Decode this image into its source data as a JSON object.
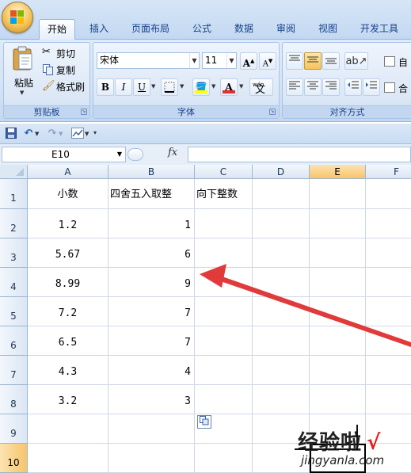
{
  "ribbon_tabs": [
    "开始",
    "插入",
    "页面布局",
    "公式",
    "数据",
    "审阅",
    "视图",
    "开发工具"
  ],
  "clipboard": {
    "paste_label": "粘贴",
    "cut_label": "剪切",
    "copy_label": "复制",
    "format_painter_label": "格式刷",
    "group_label": "剪贴板"
  },
  "font": {
    "name": "宋体",
    "size": "11",
    "grow_label": "A",
    "shrink_label": "A",
    "bold_label": "B",
    "italic_label": "I",
    "underline_label": "U",
    "color_label": "A",
    "phonetic_label": "wén",
    "phonetic_char": "文",
    "group_label": "字体"
  },
  "alignment": {
    "group_label": "对齐方式",
    "wrap_label_part": "自",
    "merge_label_part": "合"
  },
  "formula_bar": {
    "name_box": "E10",
    "fx_label": "fx",
    "formula": ""
  },
  "columns": [
    "A",
    "B",
    "C",
    "D",
    "E",
    "F"
  ],
  "selected_column": "E",
  "selected_row": "10",
  "row_numbers": [
    "1",
    "2",
    "3",
    "4",
    "5",
    "6",
    "7",
    "8",
    "9",
    "10"
  ],
  "table": {
    "headers": [
      "小数",
      "四舍五入取整",
      "向下整数"
    ],
    "rows": [
      [
        "1.2",
        "1"
      ],
      [
        "5.67",
        "6"
      ],
      [
        "8.99",
        "9"
      ],
      [
        "7.2",
        "7"
      ],
      [
        "6.5",
        "7"
      ],
      [
        "4.3",
        "4"
      ],
      [
        "3.2",
        "3"
      ]
    ]
  },
  "watermark": {
    "text": "经验啦",
    "check": "√",
    "url": "jingyanla.com"
  },
  "colors": {
    "accent_blue": "#15428b",
    "selected_header": "#f7c46a",
    "arrow_red": "#e03a3a"
  }
}
